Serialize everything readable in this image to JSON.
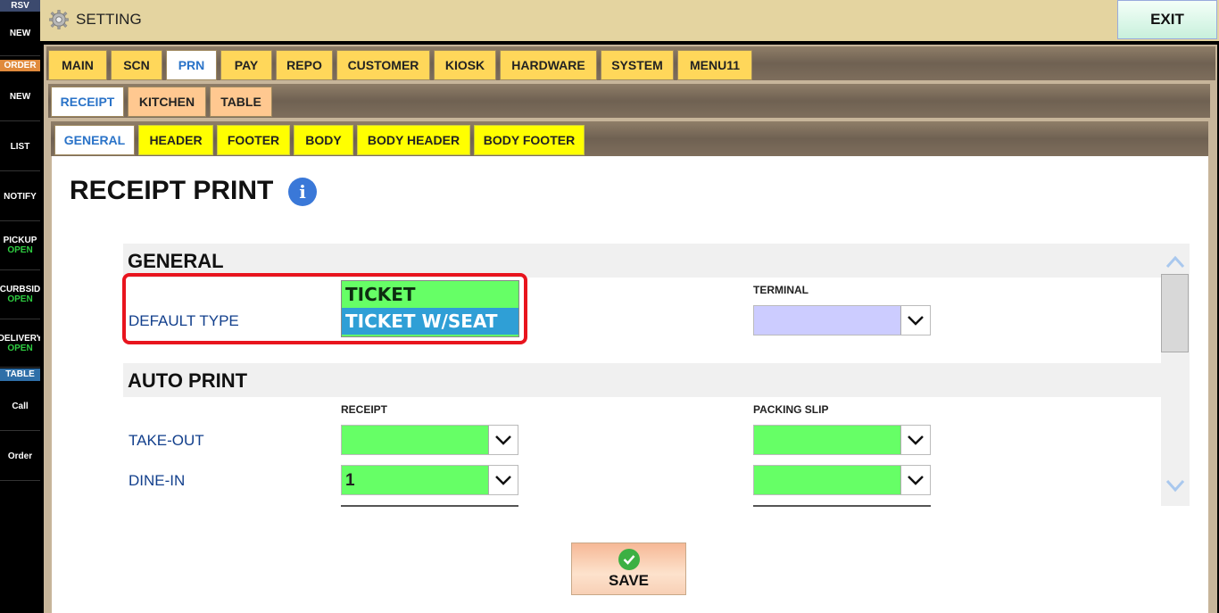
{
  "sidebar": {
    "rsv_header": "RSV",
    "rsv_new": "NEW",
    "order_header": "ORDER",
    "order_new": "NEW",
    "list": "LIST",
    "notify": "NOTIFY",
    "pickup": "PICKUP",
    "pickup_status": "OPEN",
    "curbside": "CURBSID",
    "curbside_status": "OPEN",
    "delivery": "DELIVERY",
    "delivery_status": "OPEN",
    "table_header": "TABLE",
    "call": "Call",
    "order": "Order"
  },
  "topbar": {
    "title": "SETTING",
    "exit": "EXIT"
  },
  "main_tabs": [
    "MAIN",
    "SCN",
    "PRN",
    "PAY",
    "REPO",
    "CUSTOMER",
    "KIOSK",
    "HARDWARE",
    "SYSTEM",
    "MENU11"
  ],
  "main_tab_selected": "PRN",
  "sub_tabs": [
    "RECEIPT",
    "KITCHEN",
    "TABLE"
  ],
  "sub_tab_selected": "RECEIPT",
  "section_tabs": [
    "GENERAL",
    "HEADER",
    "FOOTER",
    "BODY",
    "BODY HEADER",
    "BODY FOOTER"
  ],
  "section_tab_selected": "GENERAL",
  "page": {
    "title": "RECEIPT PRINT",
    "general": {
      "header": "GENERAL",
      "terminal_label": "TERMINAL",
      "default_type_label": "DEFAULT TYPE",
      "default_type_options": [
        "TICKET",
        "TICKET W/SEAT"
      ],
      "default_type_selected": "TICKET W/SEAT",
      "terminal_value": ""
    },
    "auto_print": {
      "header": "AUTO PRINT",
      "col_receipt": "RECEIPT",
      "col_packing_slip": "PACKING SLIP",
      "takeout_label": "TAKE-OUT",
      "takeout_receipt": "",
      "takeout_packing": "",
      "dinein_label": "DINE-IN",
      "dinein_receipt": "1",
      "dinein_packing": ""
    },
    "save_label": "SAVE"
  },
  "colors": {
    "tab_yellow": "#ffd75a",
    "tab_bright_yellow": "#ffff00",
    "tab_peach": "#ffc890",
    "field_green": "#66ff66",
    "field_lavender": "#ccccff",
    "selected_option": "#2f9fd6",
    "highlight_red": "#e8141e"
  }
}
